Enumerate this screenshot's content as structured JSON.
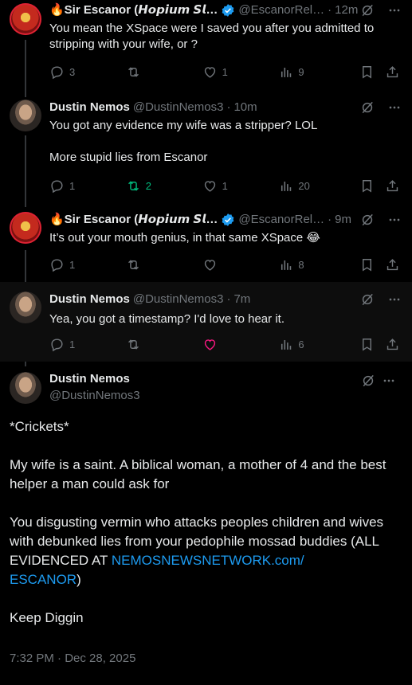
{
  "tweets": [
    {
      "author": "🔥Sir Escanor (𝙃𝙤𝙥𝙞𝙪𝙢 𝙎𝙡…",
      "handle": "@EscanorRel…",
      "time": "12m",
      "text": "You mean the XSpace were I saved you after you admitted to stripping with your wife, or ?",
      "replies": "3",
      "reposts": "",
      "likes": "1",
      "views": "9"
    },
    {
      "author": "Dustin Nemos",
      "handle": "@DustinNemos3",
      "time": "10m",
      "text": "You got any evidence my wife was a stripper? LOL\n\nMore stupid lies from Escanor",
      "replies": "1",
      "reposts": "2",
      "likes": "1",
      "views": "20"
    },
    {
      "author": "🔥Sir Escanor (𝙃𝙤𝙥𝙞𝙪𝙢 𝙎𝙡…",
      "handle": "@EscanorRel…",
      "time": "9m",
      "text": "It’s out your mouth genius, in that same XSpace 😂",
      "replies": "1",
      "reposts": "",
      "likes": "",
      "views": "8"
    },
    {
      "author": "Dustin Nemos",
      "handle": "@DustinNemos3",
      "time": "7m",
      "text": "Yea, you got a timestamp? I'd love to hear it.",
      "replies": "1",
      "reposts": "",
      "likes": "",
      "views": "6"
    }
  ],
  "main": {
    "author": "Dustin Nemos",
    "handle": "@DustinNemos3",
    "text_before_link": "*Crickets*\n\nMy wife is a saint. A biblical woman, a mother of 4 and the best helper a man could ask for\n\nYou disgusting vermin who attacks peoples children and wives with debunked lies from your pedophile mossad buddies (ALL EVIDENCED AT ",
    "link": "NEMOSNEWSNETWORK.com/\nESCANOR",
    "text_after_link": ")\n\nKeep Diggin",
    "timestamp": "7:32 PM · Dec 28, 2025"
  },
  "separator": "·",
  "colors": {
    "background": "#000000",
    "text": "#e7e9ea",
    "muted": "#71767b",
    "link": "#1d9bf0",
    "repost_active": "#00ba7c",
    "like_hover": "#f91880",
    "verified": "#1d9bf0"
  },
  "icons": [
    "reply-icon",
    "repost-icon",
    "like-icon",
    "views-icon",
    "bookmark-icon",
    "share-icon",
    "grok-icon",
    "more-icon",
    "verified-badge-icon"
  ]
}
